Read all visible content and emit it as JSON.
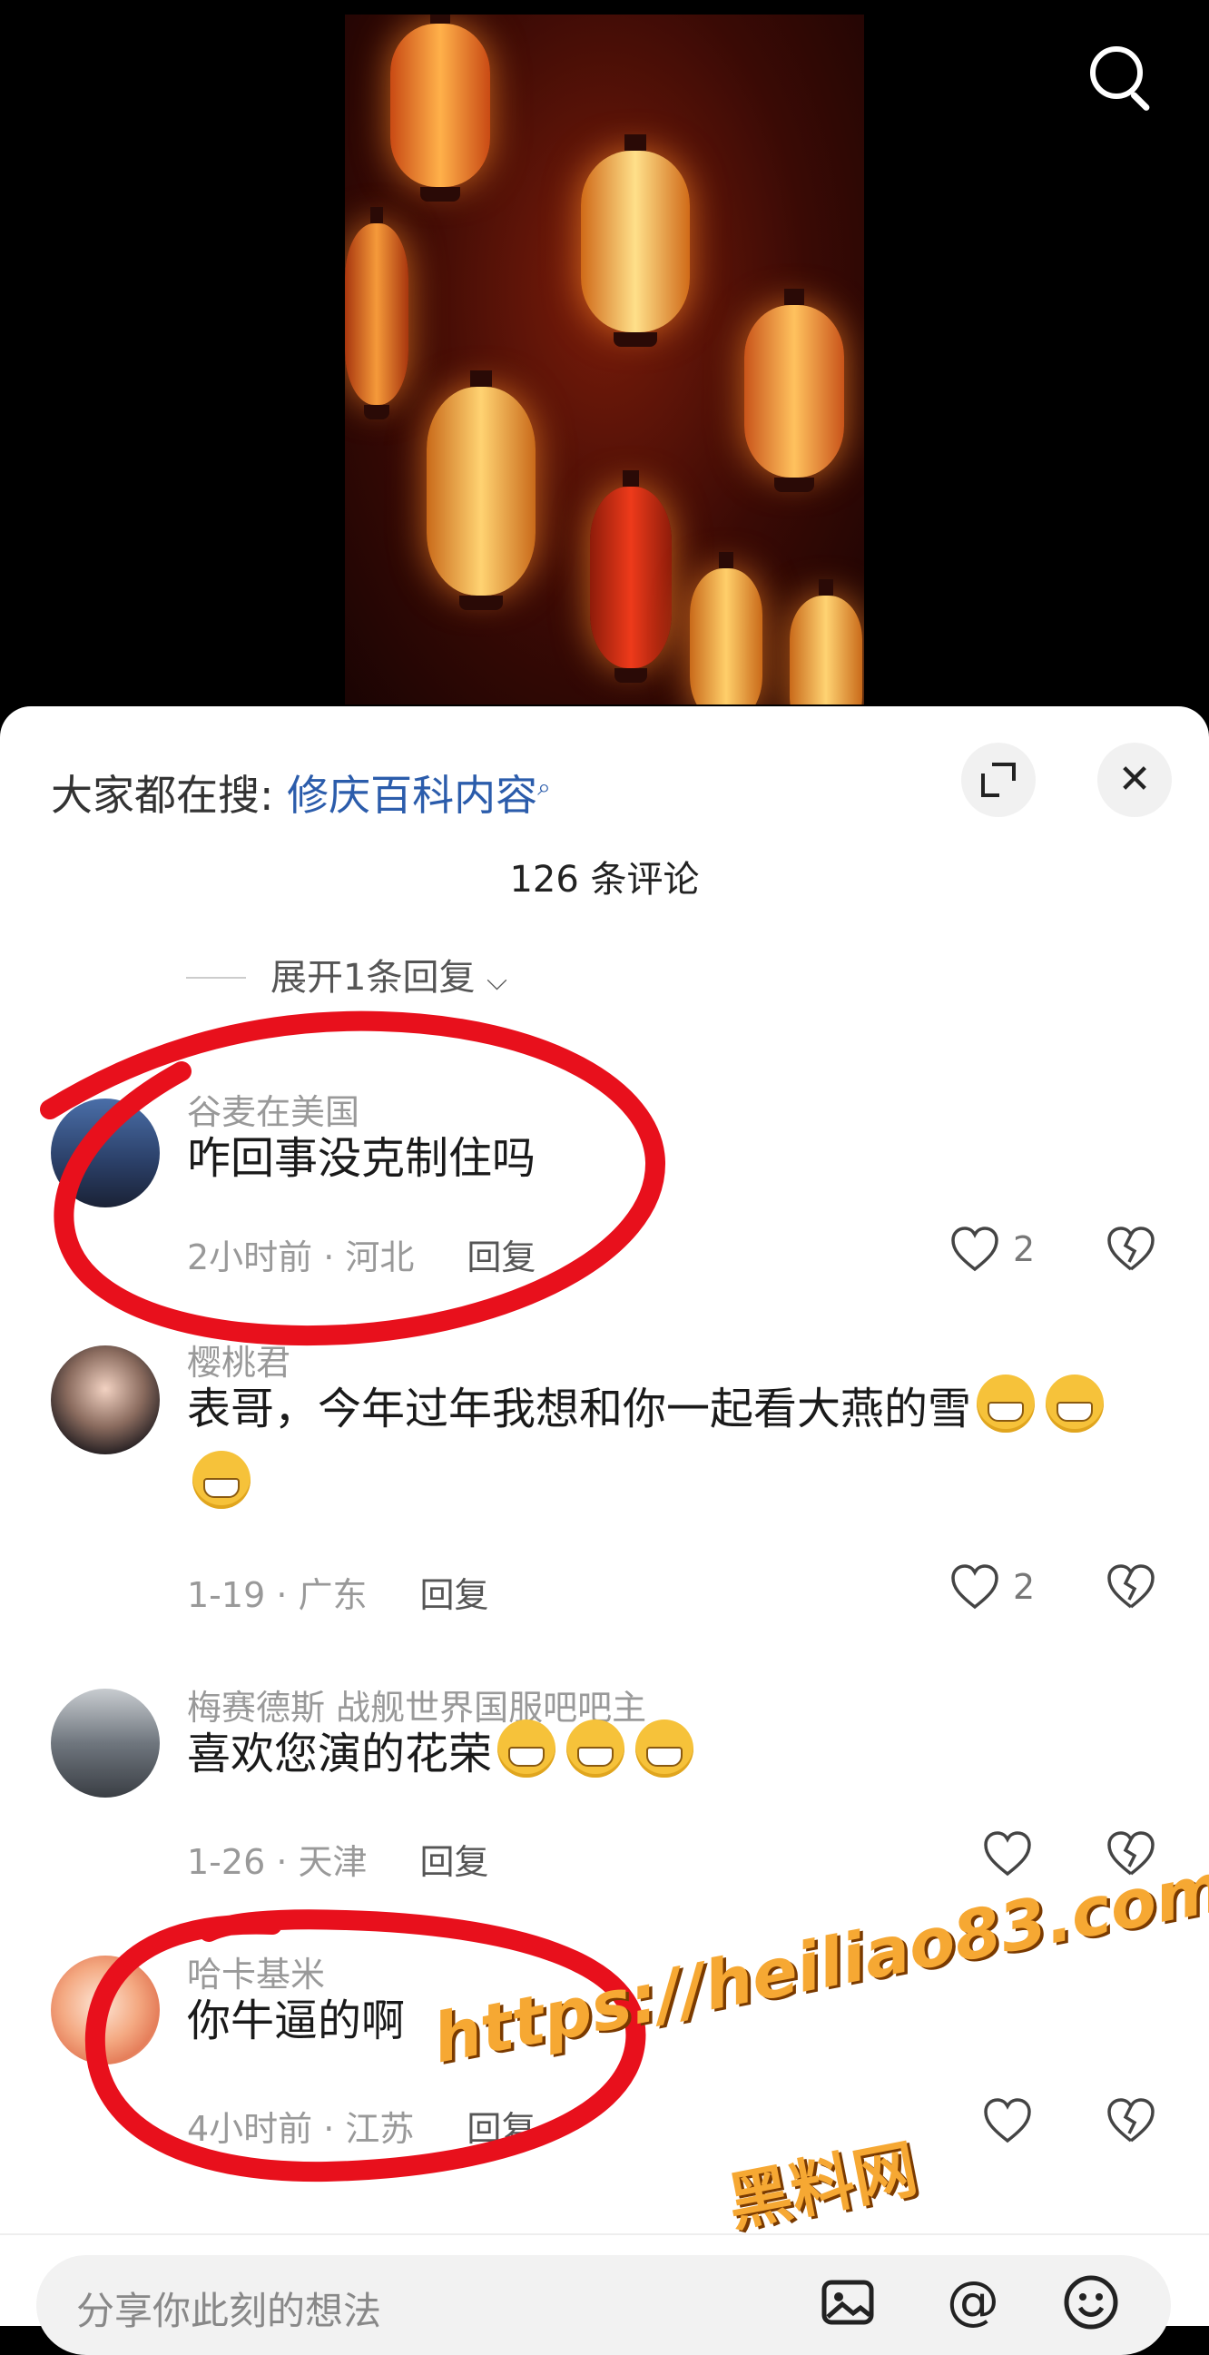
{
  "search_icon": "search-icon",
  "panel": {
    "everyone_label": "大家都在搜:",
    "search_keyword": "修庆百科内容",
    "comment_count": "126 条评论",
    "expand_replies": "展开1条回复"
  },
  "comments": [
    {
      "user": "谷麦在美国",
      "text": "咋回事没克制住吗",
      "time_location": "2小时前 · 河北",
      "reply": "回复",
      "likes": "2"
    },
    {
      "user": "樱桃君",
      "text": "表哥，今年过年我想和你一起看大燕的雪",
      "time_location": "1-19 · 广东",
      "reply": "回复",
      "likes": "2"
    },
    {
      "user": "梅赛德斯 战舰世界国服吧吧主",
      "text": "喜欢您演的花荣",
      "time_location": "1-26 · 天津",
      "reply": "回复",
      "likes": ""
    },
    {
      "user": "哈卡基米",
      "text": "你牛逼的啊",
      "time_location": "4小时前 · 江苏",
      "reply": "回复",
      "likes": ""
    }
  ],
  "input_placeholder": "分享你此刻的想法",
  "watermark": {
    "url": "https://heiliao83.com",
    "name": "黑料网"
  },
  "colors": {
    "keyword": "#2b5cab",
    "annotation": "#e8101c",
    "watermark": "#f6a833"
  }
}
